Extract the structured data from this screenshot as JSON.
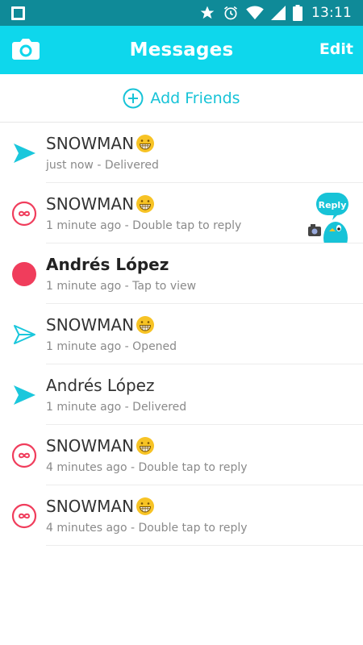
{
  "status_bar": {
    "time": "13:11",
    "icons": [
      "star-icon",
      "alarm-icon",
      "wifi-icon",
      "signal-icon",
      "battery-icon"
    ]
  },
  "header": {
    "title": "Messages",
    "edit_label": "Edit",
    "camera_icon": "camera-icon"
  },
  "add_friends": {
    "label": "Add Friends",
    "icon": "plus-circle-icon"
  },
  "colors": {
    "status_bar": "#0f8a98",
    "header": "#0ed7ec",
    "accent": "#17c3d7",
    "red": "#f03d5c",
    "arrow": "#1ac7dc"
  },
  "messages": [
    {
      "name": "SNOWMAN",
      "status": "just now - Delivered",
      "icon": "filled-arrow-icon",
      "emoji": "grinning-emoji"
    },
    {
      "name": "SNOWMAN",
      "status": "1 minute ago - Double tap to reply",
      "icon": "replay-icon",
      "emoji": "grinning-emoji",
      "reply_label": "Reply"
    },
    {
      "name": "Andrés López",
      "status": "1 minute ago - Tap to view",
      "icon": "red-dot-icon"
    },
    {
      "name": "SNOWMAN",
      "status": "1 minute ago - Opened",
      "icon": "outline-arrow-icon",
      "emoji": "grinning-emoji"
    },
    {
      "name": "Andrés López",
      "status": "1 minute ago - Delivered",
      "icon": "filled-arrow-icon"
    },
    {
      "name": "SNOWMAN",
      "status": "4 minutes ago - Double tap to reply",
      "icon": "replay-icon",
      "emoji": "grinning-emoji"
    },
    {
      "name": "SNOWMAN",
      "status": "4 minutes ago - Double tap to reply",
      "icon": "replay-icon",
      "emoji": "grinning-emoji"
    }
  ]
}
